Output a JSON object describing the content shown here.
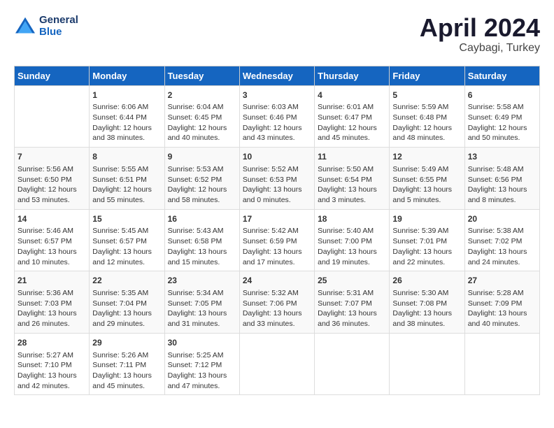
{
  "header": {
    "logo_line1": "General",
    "logo_line2": "Blue",
    "month": "April 2024",
    "location": "Caybagi, Turkey"
  },
  "days_of_week": [
    "Sunday",
    "Monday",
    "Tuesday",
    "Wednesday",
    "Thursday",
    "Friday",
    "Saturday"
  ],
  "weeks": [
    [
      {
        "day": "",
        "info": ""
      },
      {
        "day": "1",
        "info": "Sunrise: 6:06 AM\nSunset: 6:44 PM\nDaylight: 12 hours\nand 38 minutes."
      },
      {
        "day": "2",
        "info": "Sunrise: 6:04 AM\nSunset: 6:45 PM\nDaylight: 12 hours\nand 40 minutes."
      },
      {
        "day": "3",
        "info": "Sunrise: 6:03 AM\nSunset: 6:46 PM\nDaylight: 12 hours\nand 43 minutes."
      },
      {
        "day": "4",
        "info": "Sunrise: 6:01 AM\nSunset: 6:47 PM\nDaylight: 12 hours\nand 45 minutes."
      },
      {
        "day": "5",
        "info": "Sunrise: 5:59 AM\nSunset: 6:48 PM\nDaylight: 12 hours\nand 48 minutes."
      },
      {
        "day": "6",
        "info": "Sunrise: 5:58 AM\nSunset: 6:49 PM\nDaylight: 12 hours\nand 50 minutes."
      }
    ],
    [
      {
        "day": "7",
        "info": "Sunrise: 5:56 AM\nSunset: 6:50 PM\nDaylight: 12 hours\nand 53 minutes."
      },
      {
        "day": "8",
        "info": "Sunrise: 5:55 AM\nSunset: 6:51 PM\nDaylight: 12 hours\nand 55 minutes."
      },
      {
        "day": "9",
        "info": "Sunrise: 5:53 AM\nSunset: 6:52 PM\nDaylight: 12 hours\nand 58 minutes."
      },
      {
        "day": "10",
        "info": "Sunrise: 5:52 AM\nSunset: 6:53 PM\nDaylight: 13 hours\nand 0 minutes."
      },
      {
        "day": "11",
        "info": "Sunrise: 5:50 AM\nSunset: 6:54 PM\nDaylight: 13 hours\nand 3 minutes."
      },
      {
        "day": "12",
        "info": "Sunrise: 5:49 AM\nSunset: 6:55 PM\nDaylight: 13 hours\nand 5 minutes."
      },
      {
        "day": "13",
        "info": "Sunrise: 5:48 AM\nSunset: 6:56 PM\nDaylight: 13 hours\nand 8 minutes."
      }
    ],
    [
      {
        "day": "14",
        "info": "Sunrise: 5:46 AM\nSunset: 6:57 PM\nDaylight: 13 hours\nand 10 minutes."
      },
      {
        "day": "15",
        "info": "Sunrise: 5:45 AM\nSunset: 6:57 PM\nDaylight: 13 hours\nand 12 minutes."
      },
      {
        "day": "16",
        "info": "Sunrise: 5:43 AM\nSunset: 6:58 PM\nDaylight: 13 hours\nand 15 minutes."
      },
      {
        "day": "17",
        "info": "Sunrise: 5:42 AM\nSunset: 6:59 PM\nDaylight: 13 hours\nand 17 minutes."
      },
      {
        "day": "18",
        "info": "Sunrise: 5:40 AM\nSunset: 7:00 PM\nDaylight: 13 hours\nand 19 minutes."
      },
      {
        "day": "19",
        "info": "Sunrise: 5:39 AM\nSunset: 7:01 PM\nDaylight: 13 hours\nand 22 minutes."
      },
      {
        "day": "20",
        "info": "Sunrise: 5:38 AM\nSunset: 7:02 PM\nDaylight: 13 hours\nand 24 minutes."
      }
    ],
    [
      {
        "day": "21",
        "info": "Sunrise: 5:36 AM\nSunset: 7:03 PM\nDaylight: 13 hours\nand 26 minutes."
      },
      {
        "day": "22",
        "info": "Sunrise: 5:35 AM\nSunset: 7:04 PM\nDaylight: 13 hours\nand 29 minutes."
      },
      {
        "day": "23",
        "info": "Sunrise: 5:34 AM\nSunset: 7:05 PM\nDaylight: 13 hours\nand 31 minutes."
      },
      {
        "day": "24",
        "info": "Sunrise: 5:32 AM\nSunset: 7:06 PM\nDaylight: 13 hours\nand 33 minutes."
      },
      {
        "day": "25",
        "info": "Sunrise: 5:31 AM\nSunset: 7:07 PM\nDaylight: 13 hours\nand 36 minutes."
      },
      {
        "day": "26",
        "info": "Sunrise: 5:30 AM\nSunset: 7:08 PM\nDaylight: 13 hours\nand 38 minutes."
      },
      {
        "day": "27",
        "info": "Sunrise: 5:28 AM\nSunset: 7:09 PM\nDaylight: 13 hours\nand 40 minutes."
      }
    ],
    [
      {
        "day": "28",
        "info": "Sunrise: 5:27 AM\nSunset: 7:10 PM\nDaylight: 13 hours\nand 42 minutes."
      },
      {
        "day": "29",
        "info": "Sunrise: 5:26 AM\nSunset: 7:11 PM\nDaylight: 13 hours\nand 45 minutes."
      },
      {
        "day": "30",
        "info": "Sunrise: 5:25 AM\nSunset: 7:12 PM\nDaylight: 13 hours\nand 47 minutes."
      },
      {
        "day": "",
        "info": ""
      },
      {
        "day": "",
        "info": ""
      },
      {
        "day": "",
        "info": ""
      },
      {
        "day": "",
        "info": ""
      }
    ]
  ]
}
